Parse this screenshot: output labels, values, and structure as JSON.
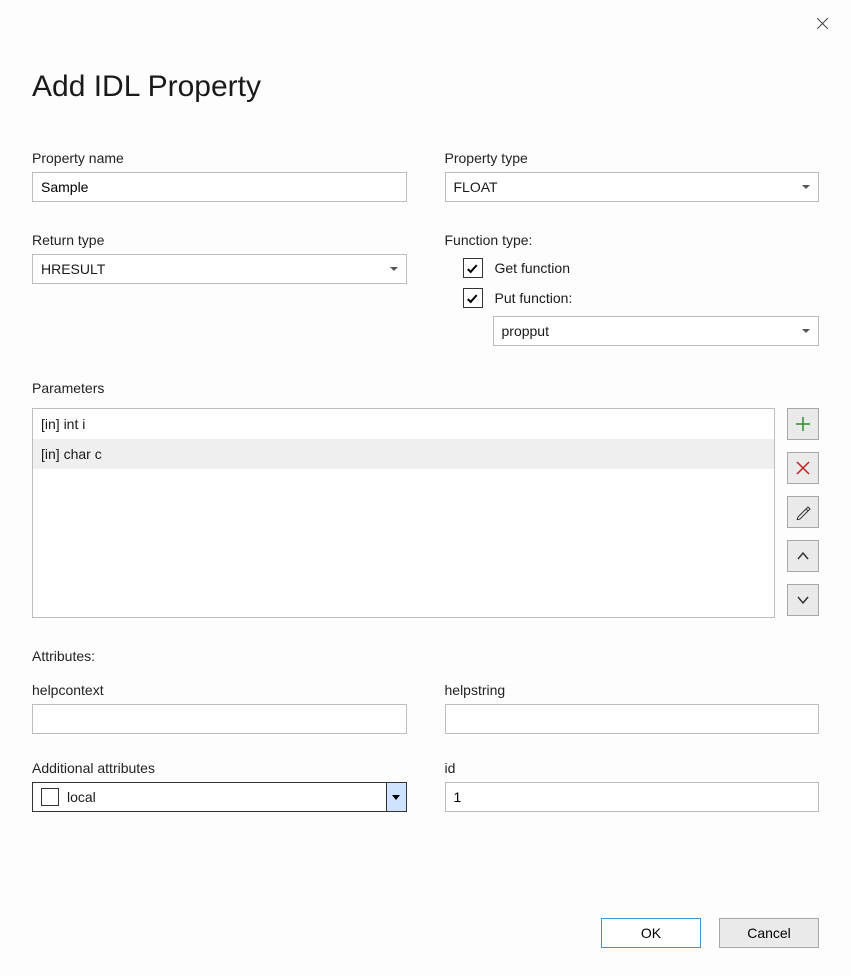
{
  "title": "Add IDL Property",
  "labels": {
    "property_name": "Property name",
    "property_type": "Property type",
    "return_type": "Return type",
    "function_type": "Function type:",
    "get_function": "Get function",
    "put_function": "Put function:",
    "parameters": "Parameters",
    "attributes": "Attributes:",
    "helpcontext": "helpcontext",
    "helpstring": "helpstring",
    "additional_attributes": "Additional attributes",
    "id": "id"
  },
  "values": {
    "property_name": "Sample",
    "property_type": "FLOAT",
    "return_type": "HRESULT",
    "get_function_checked": true,
    "put_function_checked": true,
    "put_function_select": "propput",
    "helpcontext": "",
    "helpstring": "",
    "additional_attributes_selected": "local",
    "additional_attributes_checked": false,
    "id": "1"
  },
  "parameters": [
    "[in] int i",
    "[in] char c"
  ],
  "selected_param_index": 1,
  "buttons": {
    "ok": "OK",
    "cancel": "Cancel"
  }
}
